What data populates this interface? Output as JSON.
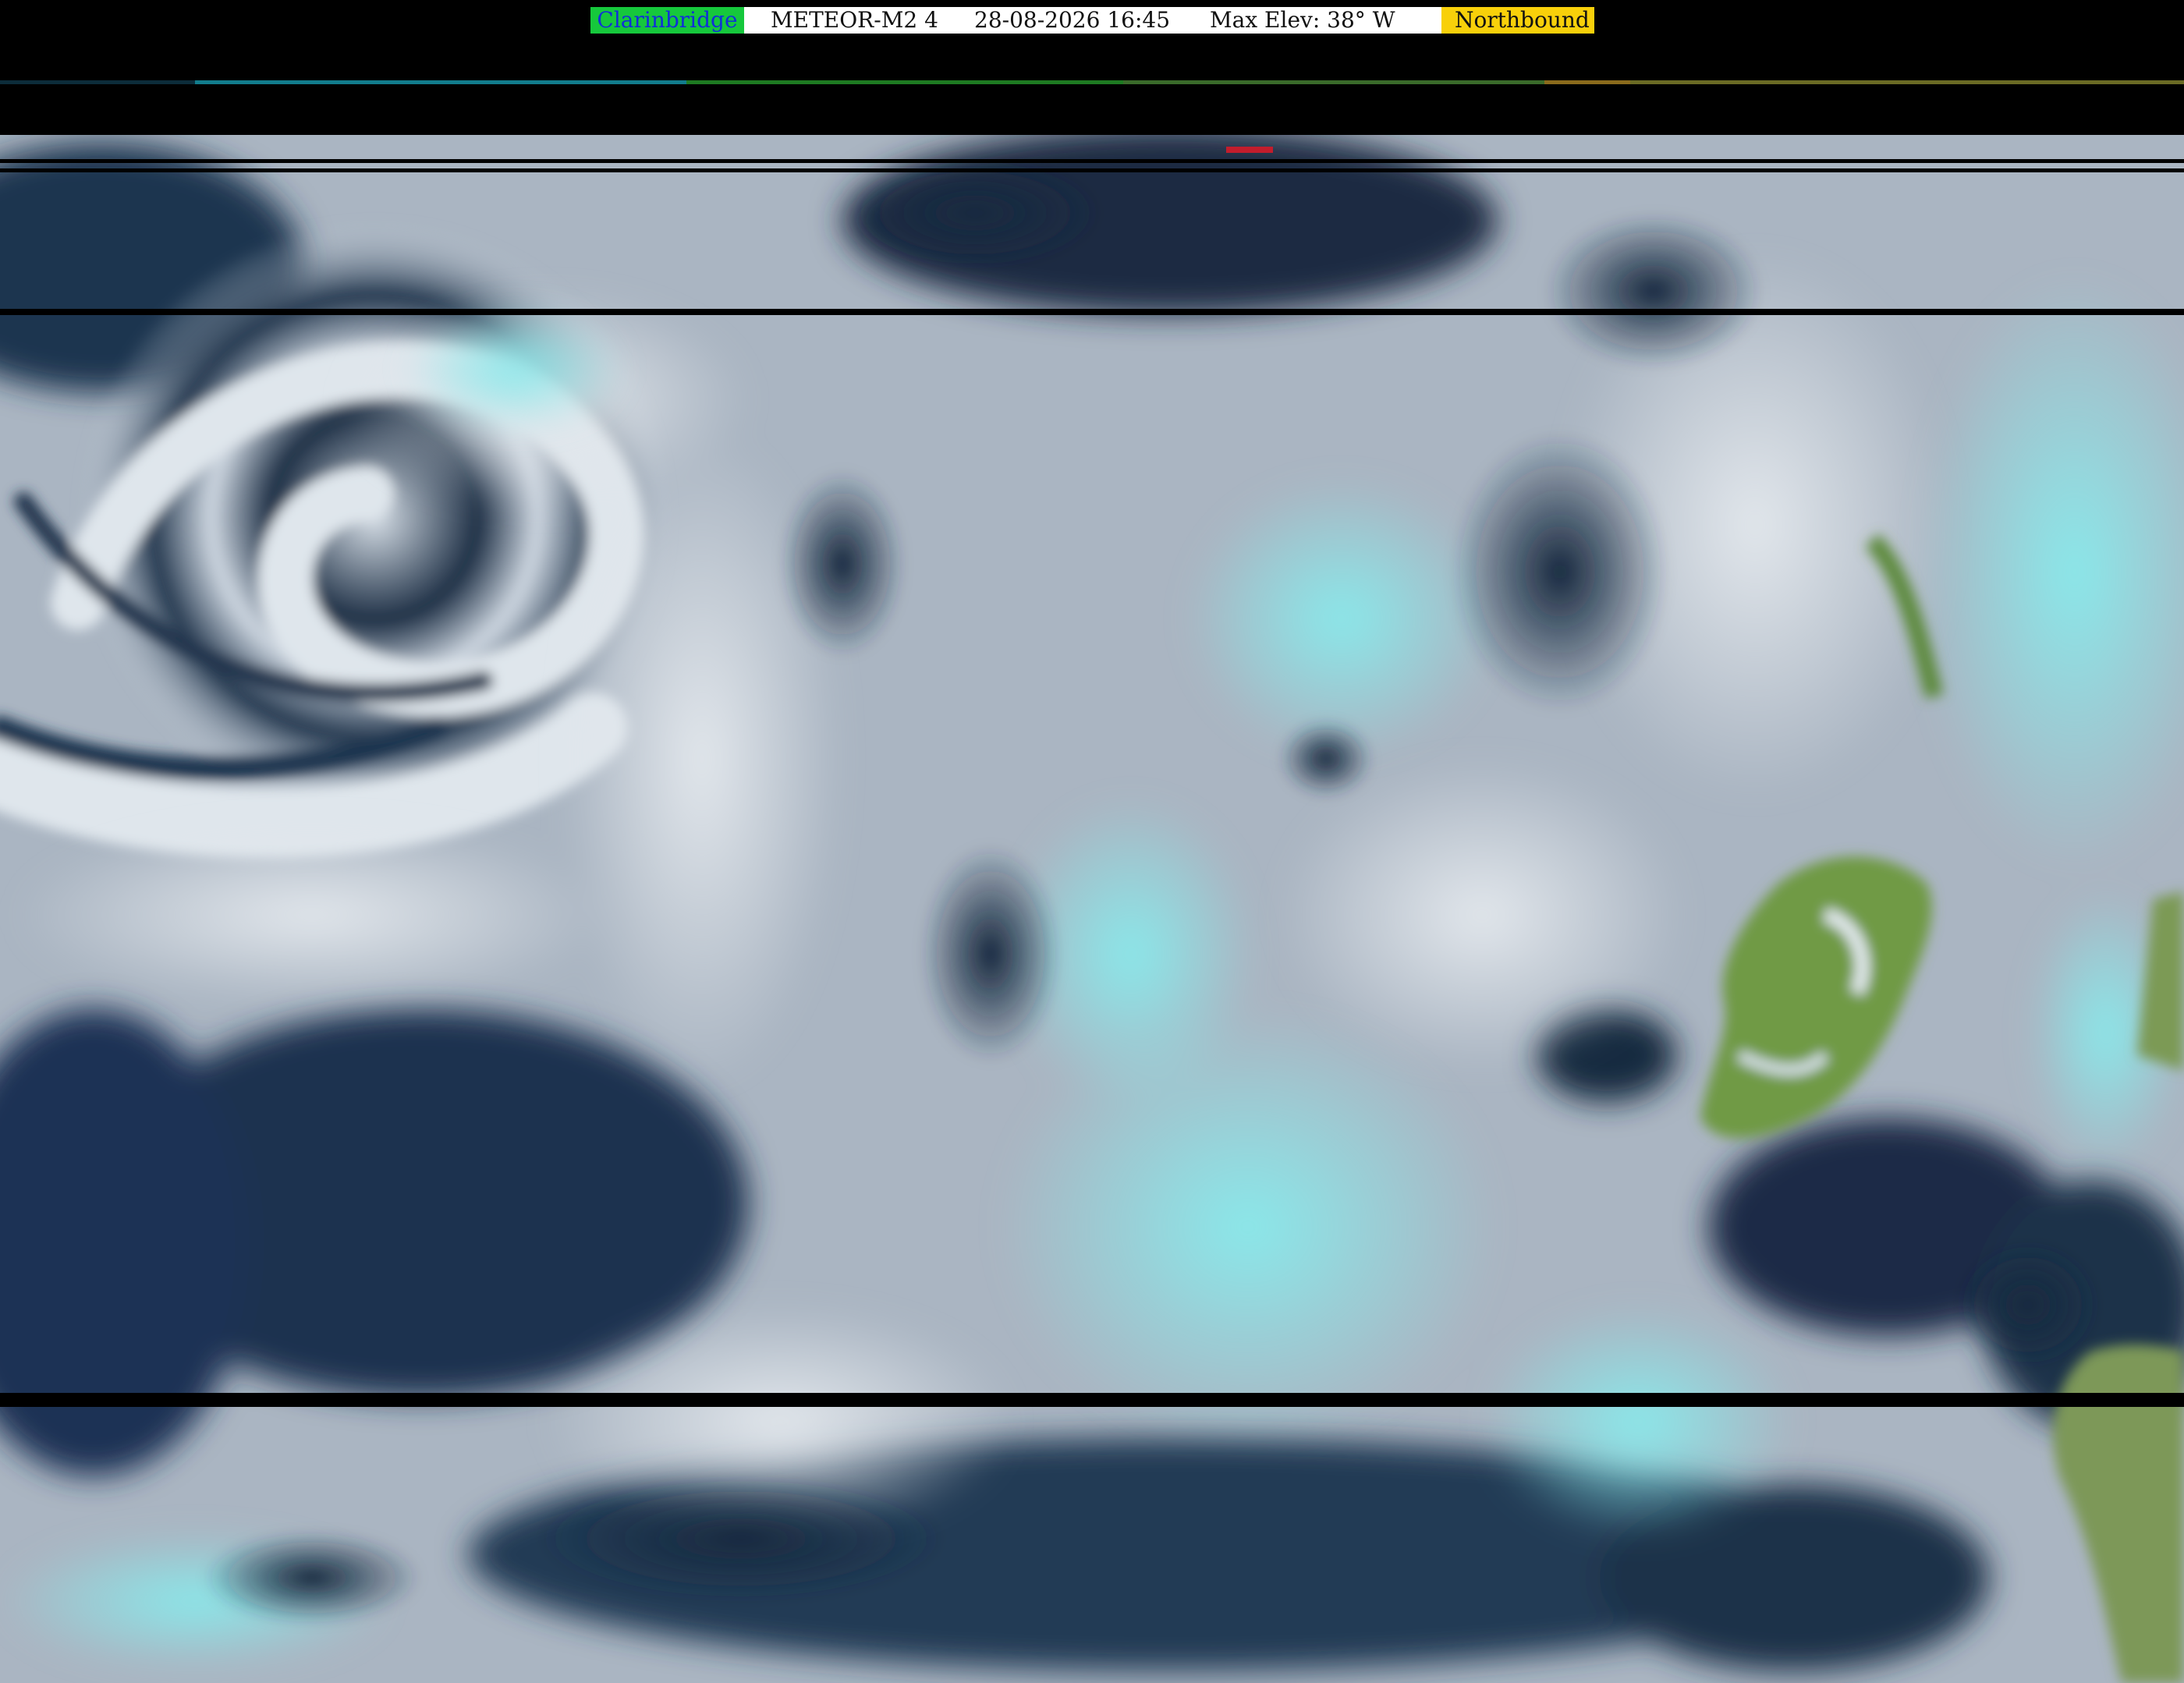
{
  "banner": {
    "station": "Clarinbridge",
    "satellite": "METEOR-M2 4",
    "datetime": "28-08-2026 16:45",
    "max_elevation": "Max Elev: 38° W",
    "direction": "Northbound"
  },
  "colors": {
    "station_bg": "#16c83c",
    "station_text": "#1030d8",
    "direction_bg": "#f8d00a",
    "ocean": "#1b3250",
    "cloud": "#d9dfe6",
    "ice_cloud": "#7ee3e6",
    "land": "#6f9a45"
  }
}
